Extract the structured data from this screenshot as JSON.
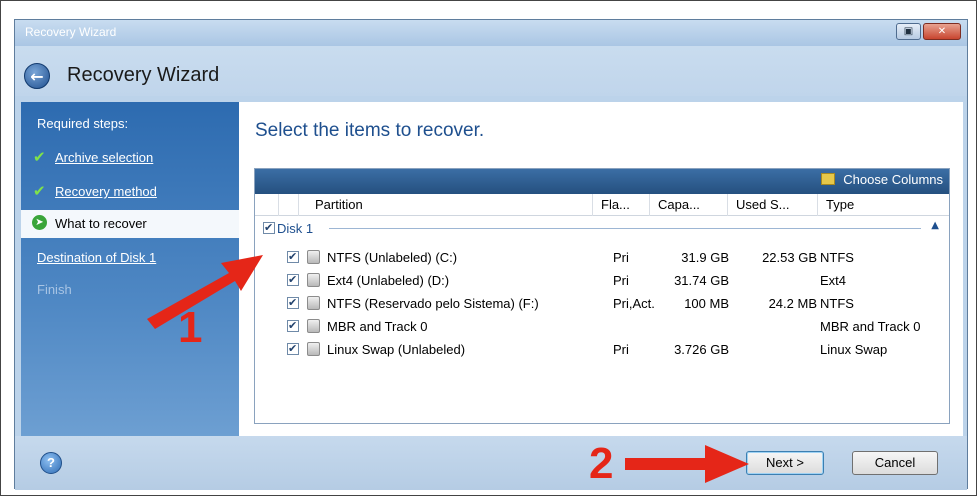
{
  "window": {
    "title": "Recovery Wizard",
    "heading": "Recovery Wizard",
    "controls": {
      "restore_glyph": "▣",
      "close_glyph": "✕"
    }
  },
  "sidebar": {
    "section_label": "Required steps:",
    "steps": [
      {
        "label": "Archive selection",
        "state": "done"
      },
      {
        "label": "Recovery method",
        "state": "done"
      },
      {
        "label": "What to recover",
        "state": "current"
      },
      {
        "label": "Destination of Disk 1",
        "state": "pending"
      },
      {
        "label": "Finish",
        "state": "disabled"
      }
    ]
  },
  "content": {
    "instruction": "Select the items to recover.",
    "toolbar": {
      "choose_columns": "Choose Columns"
    },
    "columns": [
      "Partition",
      "Fla...",
      "Capa...",
      "Used S...",
      "Type"
    ],
    "group": {
      "label": "Disk 1",
      "checked": true,
      "collapse_glyph": "▲"
    },
    "rows": [
      {
        "checked": true,
        "name": "NTFS (Unlabeled) (C:)",
        "flags": "Pri",
        "capacity": "31.9 GB",
        "used": "22.53 GB",
        "type": "NTFS"
      },
      {
        "checked": true,
        "name": "Ext4 (Unlabeled) (D:)",
        "flags": "Pri",
        "capacity": "31.74 GB",
        "used": "",
        "type": "Ext4"
      },
      {
        "checked": true,
        "name": "NTFS (Reservado pelo Sistema) (F:)",
        "flags": "Pri,Act.",
        "capacity": "100 MB",
        "used": "24.2 MB",
        "type": "NTFS"
      },
      {
        "checked": true,
        "name": "MBR and Track 0",
        "flags": "",
        "capacity": "",
        "used": "",
        "type": "MBR and Track 0"
      },
      {
        "checked": true,
        "name": "Linux Swap (Unlabeled)",
        "flags": "Pri",
        "capacity": "3.726 GB",
        "used": "",
        "type": "Linux Swap"
      }
    ]
  },
  "footer": {
    "help_glyph": "?",
    "next_label": "Next >",
    "cancel_label": "Cancel"
  },
  "annotations": {
    "marker_1": "1",
    "marker_2": "2",
    "color": "#e52618"
  },
  "colors": {
    "accent": "#1e4f8e",
    "sidebar": "#2d6bb0",
    "grid_toolbar": "#25507f"
  }
}
